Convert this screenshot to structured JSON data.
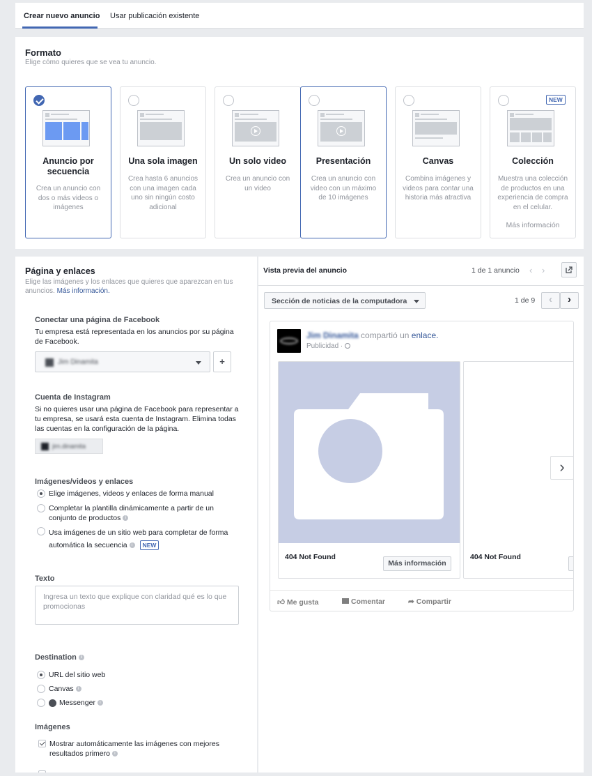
{
  "tabs": {
    "create": "Crear nuevo anuncio",
    "existing": "Usar publicación existente"
  },
  "format": {
    "title": "Formato",
    "subtitle": "Elige cómo quieres que se vea tu anuncio.",
    "cards": [
      {
        "name": "Anuncio por secuencia",
        "desc": "Crea un anuncio con dos o más videos o imágenes",
        "selected": true
      },
      {
        "name": "Una sola imagen",
        "desc": "Crea hasta 6 anuncios con una imagen cada uno sin ningún costo adicional"
      },
      {
        "name": "Un solo video",
        "desc": "Crea un anuncio con un video"
      },
      {
        "name": "Presentación",
        "desc": "Crea un anuncio con video con un máximo de 10 imágenes"
      },
      {
        "name": "Canvas",
        "desc": "Combina imágenes y videos para contar una historia más atractiva"
      },
      {
        "name": "Colección",
        "desc": "Muestra una colección de productos en una experiencia de compra en el celular.",
        "link": "Más información",
        "badge": "NEW"
      }
    ]
  },
  "page_links": {
    "title": "Página y enlaces",
    "subtitle": "Elige las imágenes y los enlaces que quieres que aparezcan en tus anuncios.",
    "more_info": "Más información.",
    "fb_page": {
      "label": "Conectar una página de Facebook",
      "desc": "Tu empresa está representada en los anuncios por su página de Facebook.",
      "value": "Jim Dinamita",
      "add": "+"
    },
    "instagram": {
      "label": "Cuenta de Instagram",
      "desc": "Si no quieres usar una página de Facebook para representar a tu empresa, se usará esta cuenta de Instagram. Elimina todas las cuentas en la configuración de la página.",
      "value": "jim.dinamita"
    },
    "media": {
      "label": "Imágenes/videos y enlaces",
      "options": [
        "Elige imágenes, videos y enlaces de forma manual",
        "Completar la plantilla dinámicamente a partir de un conjunto de productos",
        "Usa imágenes de un sitio web para completar de forma automática la secuencia"
      ],
      "new_badge": "NEW"
    },
    "text": {
      "label": "Texto",
      "placeholder": "Ingresa un texto que explique con claridad qué es lo que promocionas"
    },
    "destination": {
      "label": "Destination",
      "options": [
        "URL del sitio web",
        "Canvas",
        "Messenger"
      ]
    },
    "images": {
      "label": "Imágenes",
      "checkbox": "Mostrar automáticamente las imágenes con mejores resultados primero"
    }
  },
  "preview": {
    "title": "Vista previa del anuncio",
    "counter": "1 de 1 anuncio",
    "placement": "Sección de noticias de la computadora",
    "page_counter": "1 de 9",
    "post": {
      "page_name": "Jim Dinamita",
      "shared": "compartió un",
      "link": "enlace.",
      "sponsored": "Publicidad ·",
      "cards": [
        {
          "title": "404 Not Found",
          "cta": "Más información"
        },
        {
          "title": "404 Not Found",
          "cta": ""
        }
      ],
      "actions": [
        "Me gusta",
        "Comentar",
        "Compartir"
      ]
    }
  },
  "colors": {
    "accent": "#4267b2",
    "placeholder_img": "#c6cde4"
  }
}
